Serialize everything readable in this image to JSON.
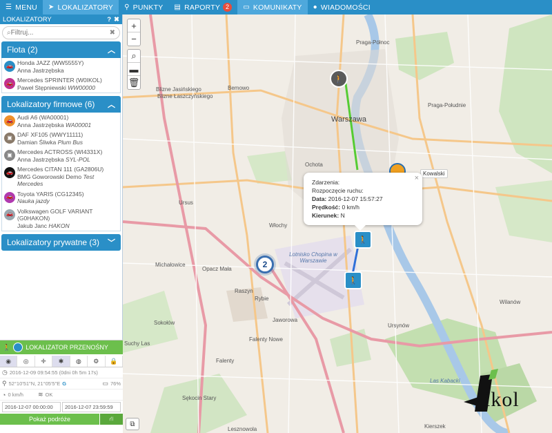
{
  "colors": {
    "nav": "#2a8fc7",
    "nav_active": "#4ea8dc",
    "badge": "#e74c3c",
    "green": "#6cbf4c",
    "route_blue": "#2f6fd8",
    "route_green": "#55cc33"
  },
  "nav": {
    "menu": "MENU",
    "lokalizatory": "LOKALIZATORY",
    "punkty": "PUNKTY",
    "raporty": "RAPORTY",
    "raporty_badge": "2",
    "komunikaty": "KOMUNIKATY",
    "wiadomosci": "WIADOMOŚCI"
  },
  "sidebar": {
    "title": "LOKALIZATORY",
    "help": "?",
    "close": "✖",
    "filter_placeholder": "Filtruj...",
    "groups": [
      {
        "label": "Flota (2)",
        "items": [
          {
            "vehicle": "Honda JAZZ (WW5555Y)",
            "driver": "Anna Jastrzębska",
            "extra": "",
            "color": "#2a8fc7",
            "icon": "car-icon"
          },
          {
            "vehicle": "Mercedes SPRINTER (W0IKOL)",
            "driver": "Paweł Stępniewski",
            "extra": "WW00000",
            "color": "#c0308f",
            "icon": "car-icon"
          }
        ]
      },
      {
        "label": "Lokalizatory firmowe (6)",
        "items": [
          {
            "vehicle": "Audi A6 (WA00001)",
            "driver": "Anna Jastrzębska",
            "extra": "WA00001",
            "color": "#f0902a",
            "icon": "car-icon"
          },
          {
            "vehicle": "DAF XF105 (WWY11111)",
            "driver": "Damian Śliwka",
            "extra": "Plum Bus",
            "color": "#8a7a6a",
            "icon": "truck-icon"
          },
          {
            "vehicle": "Mercedes ACTROSS (WI4331X)",
            "driver": "Anna Jastrzębska",
            "extra": "SYL-POL",
            "color": "#888888",
            "icon": "truck-icon"
          },
          {
            "vehicle": "Mercedes CITAN 111 (GA2806U)",
            "driver": "BMG Goworowski Demo",
            "extra": "Test Mercedes",
            "color": "#111111",
            "icon": "car-icon"
          },
          {
            "vehicle": "Toyota YARIS (CG12345)",
            "driver": "",
            "extra": "Nauka jazdy",
            "color": "#b03ab0",
            "icon": "car-icon"
          },
          {
            "vehicle": "Volkswagen GOLF VARIANT (G0HAKON)",
            "driver": "Jakub Janc",
            "extra": "HAKON",
            "color": "#9aa7b0",
            "icon": "car-icon"
          }
        ]
      },
      {
        "label": "Lokalizatory prywatne (3)",
        "items": []
      }
    ]
  },
  "detail": {
    "title": "LOKALIZATOR PRZENOŚNY",
    "last_seen": "2016-12-09 09:54:55 (0dni 0h 5m 17s)",
    "battery": "76%",
    "coords": "52°10'51\"N, 21°05'5\"E",
    "coords_flag": "G",
    "speed": "0 km/h",
    "signal": "OK",
    "date_from": "2016-12-07 00:00:00",
    "date_to": "2016-12-07 23:59:59",
    "show_route": "Pokaż podróże"
  },
  "popup": {
    "line1": "Zdarzenia:",
    "line2": "Rozpoczęcie ruchu:",
    "date_label": "Data:",
    "date_value": "2016-12-07 15:57:27",
    "speed_label": "Prędkość:",
    "speed_value": "0 km/h",
    "dir_label": "Kierunek:",
    "dir_value": "N"
  },
  "map": {
    "cluster_count": "2",
    "kowalski": "Kowalski",
    "logo_text": "ikol",
    "labels": {
      "warszawa": "Warszawa",
      "praga_polnoc": "Praga-Północ",
      "praga_poludnie": "Praga-Południe",
      "bemowo": "Bemowo",
      "blizne_jasinskiego": "Blizne Jasińskiego",
      "blizne_laszczynskiego": "Blizne Łaszczyńskiego",
      "ochota": "Ochota",
      "ursus": "Ursus",
      "wlochy": "Włochy",
      "michalowice": "Michałowice",
      "opacz_mala": "Opacz Mała",
      "raszyn": "Raszyn",
      "rybie": "Rybie",
      "jaworowa": "Jaworowa",
      "sokolow": "Sokołów",
      "falenty_nowe": "Falenty Nowe",
      "falenty": "Falenty",
      "wilanow": "Wilanów",
      "ursynow": "Ursynów",
      "las_kabacki": "Las Kabacki",
      "lotnisko": "Lotnisko Chopina w Warszawie",
      "kierszek": "Kierszek",
      "suchy_las": "Suchy Las",
      "sekocin_stary": "Sękocin Stary",
      "lesznowola": "Lesznowola"
    }
  }
}
